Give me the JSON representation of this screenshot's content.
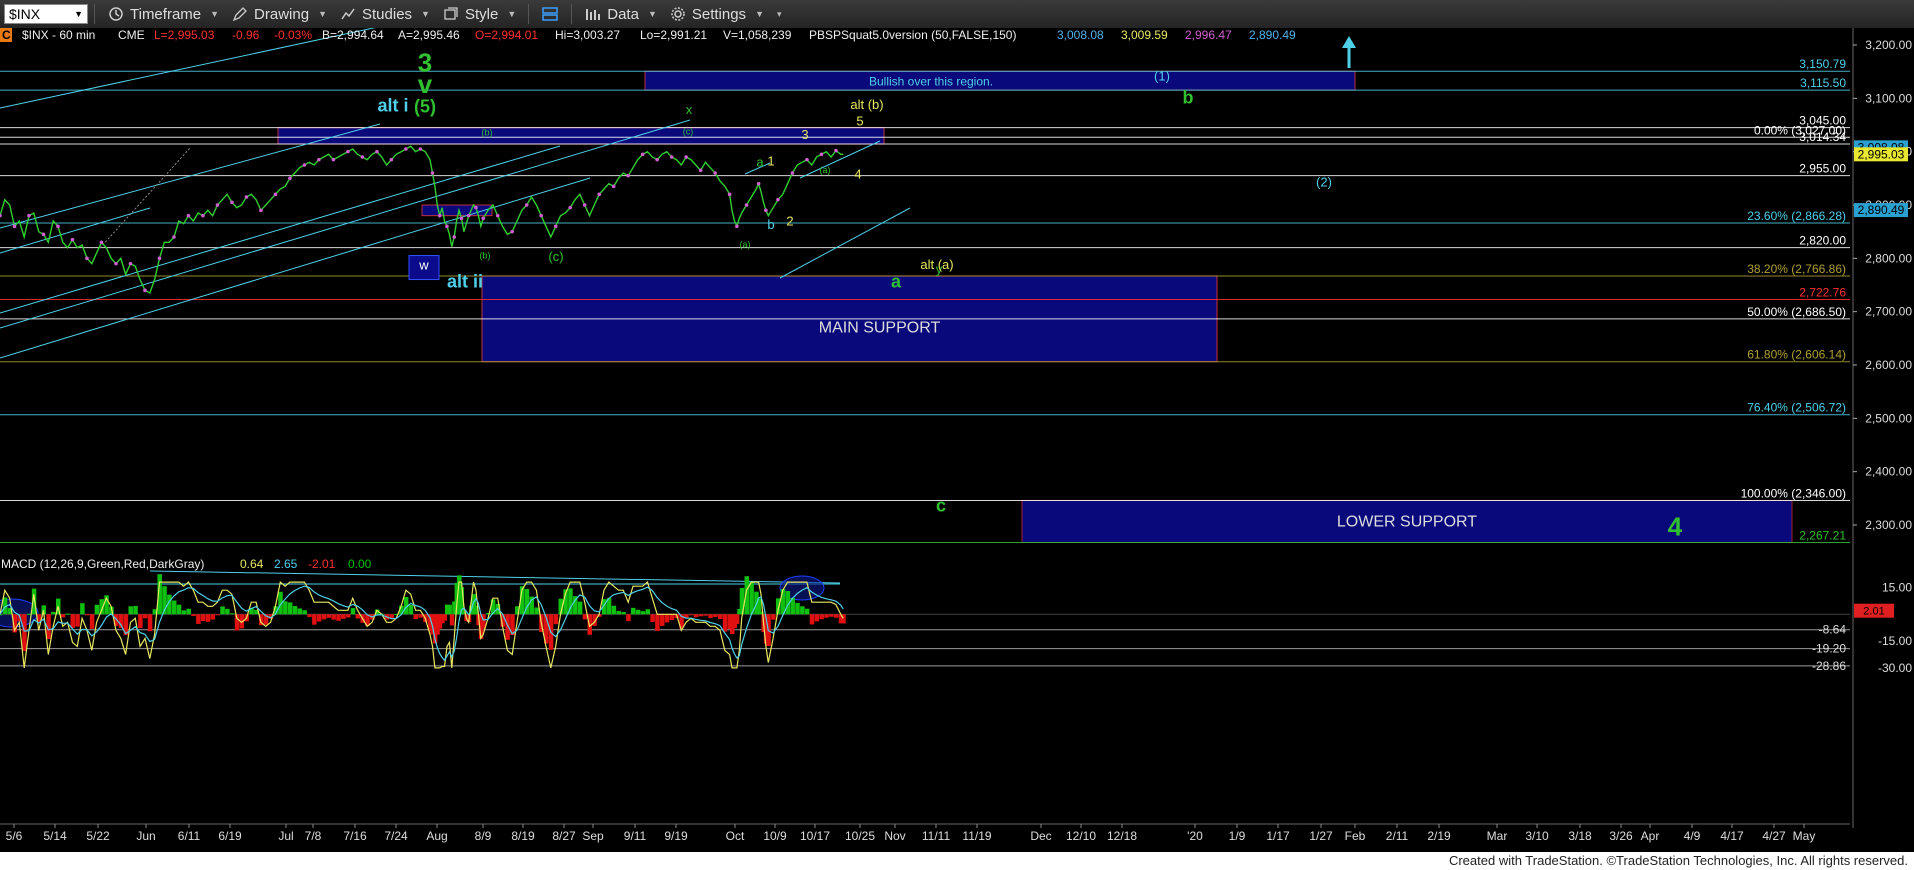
{
  "toolbar": {
    "symbol": "$INX",
    "items": [
      {
        "label": "Timeframe",
        "icon": "clock-icon"
      },
      {
        "label": "Drawing",
        "icon": "pen-icon"
      },
      {
        "label": "Studies",
        "icon": "studies-icon"
      },
      {
        "label": "Style",
        "icon": "style-icon"
      },
      {
        "label": "Data",
        "icon": "data-icon"
      },
      {
        "label": "Settings",
        "icon": "gear-icon"
      }
    ]
  },
  "header": {
    "badge": "C",
    "title": "$INX - 60 min",
    "exchange": "CME",
    "last": "L=2,995.03",
    "chg": "-0.96",
    "pct": "-0.03%",
    "bid": "B=2,994.64",
    "ask": "A=2,995.46",
    "open": "O=2,994.01",
    "hi": "Hi=3,003.27",
    "lo": "Lo=2,991.21",
    "vol": "V=1,058,239",
    "study": "PBSPSquat5.0version (50,FALSE,150)",
    "study_vals": [
      {
        "v": "3,008.08",
        "color": "#4fb3e8"
      },
      {
        "v": "3,009.59",
        "color": "#e8e860"
      },
      {
        "v": "2,996.47",
        "color": "#d060d0"
      },
      {
        "v": "2,890.49",
        "color": "#4fb3e8"
      }
    ]
  },
  "macd_header": {
    "title": "MACD (12,26,9,Green,Red,DarkGray)",
    "vals": [
      {
        "v": "0.64",
        "color": "#e8e860"
      },
      {
        "v": "2.65",
        "color": "#4fd0e8"
      },
      {
        "v": "-2.01",
        "color": "#ff3030"
      },
      {
        "v": "0.00",
        "color": "#00c000"
      }
    ]
  },
  "footer": "Created with TradeStation. ©TradeStation Technologies, Inc. All rights reserved.",
  "chart_data": {
    "type": "line",
    "title": "$INX - 60 min",
    "ylim": [
      2200,
      3220
    ],
    "y_ticks": [
      3200,
      3100,
      3000,
      2900,
      2800,
      2700,
      2600,
      2500,
      2400,
      2300
    ],
    "y_tick_labels": [
      "3,200.00",
      "3,100.00",
      "3,000.00",
      "2,900.00",
      "2,800.00",
      "2,700.00",
      "2,600.00",
      "2,500.00",
      "2,400.00",
      "2,300.00"
    ],
    "x_tick_labels": [
      "5/6",
      "5/14",
      "5/22",
      "Jun",
      "6/11",
      "6/19",
      "Jul",
      "7/8",
      "7/16",
      "7/24",
      "Aug",
      "8/9",
      "8/19",
      "8/27",
      "Sep",
      "9/11",
      "9/19",
      "Oct",
      "10/9",
      "10/17",
      "10/25",
      "Nov",
      "11/11",
      "11/19",
      "Dec",
      "12/10",
      "12/18",
      "'20",
      "1/9",
      "1/17",
      "1/27",
      "Feb",
      "2/11",
      "2/19",
      "Mar",
      "3/10",
      "3/18",
      "3/26",
      "Apr",
      "4/9",
      "4/17",
      "4/27",
      "May"
    ],
    "price_series": [
      [
        0,
        2880
      ],
      [
        4,
        2910
      ],
      [
        8,
        2900
      ],
      [
        12,
        2860
      ],
      [
        16,
        2870
      ],
      [
        20,
        2840
      ],
      [
        24,
        2880
      ],
      [
        28,
        2885
      ],
      [
        32,
        2850
      ],
      [
        36,
        2845
      ],
      [
        40,
        2830
      ],
      [
        44,
        2870
      ],
      [
        48,
        2860
      ],
      [
        52,
        2830
      ],
      [
        56,
        2820
      ],
      [
        60,
        2835
      ],
      [
        64,
        2820
      ],
      [
        68,
        2825
      ],
      [
        72,
        2800
      ],
      [
        76,
        2790
      ],
      [
        80,
        2810
      ],
      [
        84,
        2830
      ],
      [
        88,
        2820
      ],
      [
        92,
        2800
      ],
      [
        96,
        2790
      ],
      [
        100,
        2800
      ],
      [
        104,
        2770
      ],
      [
        108,
        2790
      ],
      [
        112,
        2785
      ],
      [
        116,
        2760
      ],
      [
        120,
        2740
      ],
      [
        124,
        2735
      ],
      [
        128,
        2760
      ],
      [
        132,
        2800
      ],
      [
        136,
        2830
      ],
      [
        140,
        2830
      ],
      [
        144,
        2840
      ],
      [
        148,
        2870
      ],
      [
        152,
        2865
      ],
      [
        156,
        2880
      ],
      [
        160,
        2870
      ],
      [
        164,
        2885
      ],
      [
        168,
        2880
      ],
      [
        172,
        2890
      ],
      [
        176,
        2880
      ],
      [
        180,
        2900
      ],
      [
        184,
        2910
      ],
      [
        188,
        2920
      ],
      [
        192,
        2905
      ],
      [
        196,
        2895
      ],
      [
        200,
        2900
      ],
      [
        204,
        2915
      ],
      [
        208,
        2920
      ],
      [
        212,
        2910
      ],
      [
        216,
        2890
      ],
      [
        220,
        2900
      ],
      [
        224,
        2910
      ],
      [
        228,
        2920
      ],
      [
        232,
        2930
      ],
      [
        236,
        2935
      ],
      [
        240,
        2950
      ],
      [
        244,
        2960
      ],
      [
        248,
        2970
      ],
      [
        252,
        2975
      ],
      [
        256,
        2980
      ],
      [
        260,
        2975
      ],
      [
        264,
        2985
      ],
      [
        268,
        2990
      ],
      [
        272,
        2995
      ],
      [
        276,
        2985
      ],
      [
        280,
        2990
      ],
      [
        284,
        2995
      ],
      [
        288,
        3000
      ],
      [
        292,
        3005
      ],
      [
        296,
        2995
      ],
      [
        300,
        2990
      ],
      [
        304,
        2985
      ],
      [
        308,
        2995
      ],
      [
        312,
        3000
      ],
      [
        316,
        2990
      ],
      [
        320,
        2975
      ],
      [
        324,
        2985
      ],
      [
        328,
        2995
      ],
      [
        332,
        3000
      ],
      [
        336,
        3005
      ],
      [
        340,
        3010
      ],
      [
        344,
        3000
      ],
      [
        348,
        3005
      ],
      [
        352,
        3000
      ],
      [
        356,
        2985
      ],
      [
        358,
        2960
      ],
      [
        360,
        2935
      ],
      [
        362,
        2900
      ],
      [
        364,
        2880
      ],
      [
        366,
        2895
      ],
      [
        368,
        2870
      ],
      [
        370,
        2860
      ],
      [
        372,
        2845
      ],
      [
        374,
        2822
      ],
      [
        376,
        2840
      ],
      [
        378,
        2870
      ],
      [
        380,
        2890
      ],
      [
        382,
        2875
      ],
      [
        384,
        2850
      ],
      [
        386,
        2865
      ],
      [
        388,
        2880
      ],
      [
        390,
        2890
      ],
      [
        392,
        2900
      ],
      [
        394,
        2895
      ],
      [
        396,
        2880
      ],
      [
        398,
        2860
      ],
      [
        400,
        2875
      ],
      [
        404,
        2890
      ],
      [
        408,
        2900
      ],
      [
        412,
        2880
      ],
      [
        416,
        2860
      ],
      [
        420,
        2845
      ],
      [
        424,
        2850
      ],
      [
        428,
        2870
      ],
      [
        432,
        2890
      ],
      [
        436,
        2900
      ],
      [
        440,
        2915
      ],
      [
        444,
        2900
      ],
      [
        448,
        2880
      ],
      [
        452,
        2860
      ],
      [
        456,
        2840
      ],
      [
        460,
        2860
      ],
      [
        464,
        2880
      ],
      [
        468,
        2885
      ],
      [
        472,
        2895
      ],
      [
        476,
        2910
      ],
      [
        480,
        2920
      ],
      [
        484,
        2900
      ],
      [
        488,
        2880
      ],
      [
        492,
        2900
      ],
      [
        496,
        2920
      ],
      [
        500,
        2930
      ],
      [
        504,
        2940
      ],
      [
        508,
        2935
      ],
      [
        512,
        2950
      ],
      [
        516,
        2960
      ],
      [
        520,
        2955
      ],
      [
        524,
        2970
      ],
      [
        528,
        2985
      ],
      [
        532,
        2995
      ],
      [
        536,
        3000
      ],
      [
        540,
        2990
      ],
      [
        544,
        2985
      ],
      [
        548,
        2995
      ],
      [
        552,
        3000
      ],
      [
        556,
        2990
      ],
      [
        560,
        2985
      ],
      [
        564,
        2975
      ],
      [
        568,
        2990
      ],
      [
        572,
        2985
      ],
      [
        576,
        2975
      ],
      [
        580,
        2965
      ],
      [
        584,
        2980
      ],
      [
        588,
        2970
      ],
      [
        592,
        2960
      ],
      [
        596,
        2945
      ],
      [
        600,
        2935
      ],
      [
        604,
        2920
      ],
      [
        606,
        2890
      ],
      [
        608,
        2870
      ],
      [
        610,
        2860
      ],
      [
        612,
        2875
      ],
      [
        614,
        2885
      ],
      [
        618,
        2900
      ],
      [
        622,
        2915
      ],
      [
        626,
        2930
      ],
      [
        628,
        2940
      ],
      [
        630,
        2925
      ],
      [
        632,
        2905
      ],
      [
        634,
        2890
      ],
      [
        636,
        2880
      ],
      [
        640,
        2895
      ],
      [
        644,
        2910
      ],
      [
        648,
        2920
      ],
      [
        652,
        2940
      ],
      [
        656,
        2960
      ],
      [
        660,
        2975
      ],
      [
        664,
        2980
      ],
      [
        668,
        2985
      ],
      [
        672,
        2975
      ],
      [
        676,
        2990
      ],
      [
        680,
        2995
      ],
      [
        684,
        3000
      ],
      [
        688,
        2990
      ],
      [
        692,
        3002
      ],
      [
        696,
        2995
      ],
      [
        698,
        2995
      ]
    ],
    "horizontal_levels": [
      {
        "label": "3,150.79",
        "value": 3150.79,
        "color": "#4fd0e8"
      },
      {
        "label": "3,115.50",
        "value": 3115.5,
        "color": "#4fd0e8"
      },
      {
        "label": "3,045.00",
        "value": 3045.0,
        "color": "#ffffff"
      },
      {
        "label": "0.00% (3,027.00)",
        "value": 3027.0,
        "color": "#ffffff"
      },
      {
        "label": "3,014.34",
        "value": 3014.34,
        "color": "#ffffff"
      },
      {
        "label": "2,955.00",
        "value": 2955.0,
        "color": "#ffffff"
      },
      {
        "label": "23.60% (2,866.28)",
        "value": 2866.28,
        "color": "#4fd0e8"
      },
      {
        "label": "2,820.00",
        "value": 2820.0,
        "color": "#ffffff"
      },
      {
        "label": "38.20% (2,766.86)",
        "value": 2766.86,
        "color": "#b0a030"
      },
      {
        "label": "2,722.76",
        "value": 2722.76,
        "color": "#ff3030"
      },
      {
        "label": "50.00% (2,686.50)",
        "value": 2686.5,
        "color": "#ffffff"
      },
      {
        "label": "61.80% (2,606.14)",
        "value": 2606.14,
        "color": "#b0a030"
      },
      {
        "label": "76.40% (2,506.72)",
        "value": 2506.72,
        "color": "#4fd0e8"
      },
      {
        "label": "100.00% (2,346.00)",
        "value": 2346.0,
        "color": "#ffffff"
      },
      {
        "label": "2,267.21",
        "value": 2267.21,
        "color": "#30c030"
      }
    ],
    "right_price_tags": [
      {
        "label": "3,008.08",
        "value": 3008.08,
        "bg": "#2aa0d0"
      },
      {
        "label": "2,995.03",
        "value": 2995.03,
        "bg": "#e8e830"
      },
      {
        "label": "2,890.49",
        "value": 2890.49,
        "bg": "#2aa0d0"
      }
    ],
    "zones": [
      {
        "label": "Bullish over this region.",
        "y_top": 3150.79,
        "y_bottom": 3115.5
      },
      {
        "label": "",
        "y_top": 3045,
        "y_bottom": 3014.34
      },
      {
        "label": "",
        "y_top": 2900,
        "y_bottom": 2880
      },
      {
        "label": "MAIN SUPPORT",
        "y_top": 2766.86,
        "y_bottom": 2606.14
      },
      {
        "label": "LOWER SUPPORT",
        "y_top": 2346,
        "y_bottom": 2267.21
      }
    ],
    "wave_labels": [
      {
        "text": "3",
        "color": "#30c030",
        "value": 3150,
        "size": "big"
      },
      {
        "text": "v",
        "color": "#30c030",
        "value": 3110,
        "size": "big"
      },
      {
        "text": "(5)",
        "color": "#30c030",
        "value": 3073,
        "size": "mid"
      },
      {
        "text": "alt i",
        "color": "#4fd0e8",
        "value": 3075,
        "size": "mid"
      },
      {
        "text": "x",
        "color": "#30c030",
        "value": 3071,
        "size": "small"
      },
      {
        "text": "alt (b)",
        "color": "#e8e860",
        "value": 3080,
        "size": "small"
      },
      {
        "text": "5",
        "color": "#e8e860",
        "value": 3049,
        "size": "small"
      },
      {
        "text": "(1)",
        "color": "#4fd0e8",
        "value": 3133,
        "size": "small"
      },
      {
        "text": "b",
        "color": "#30c030",
        "value": 3090,
        "size": "mid"
      },
      {
        "text": "(2)",
        "color": "#4fd0e8",
        "value": 2935,
        "size": "small"
      },
      {
        "text": "4",
        "color": "#e8e860",
        "value": 2950,
        "size": "small"
      },
      {
        "text": "1",
        "color": "#e8e860",
        "value": 2974,
        "size": "small"
      },
      {
        "text": "3",
        "color": "#e8e860",
        "value": 3024,
        "size": "small"
      },
      {
        "text": "a",
        "color": "#30c030",
        "value": 2972,
        "size": "small"
      },
      {
        "text": "b",
        "color": "#4fd0e8",
        "value": 2855,
        "size": "small"
      },
      {
        "text": "2",
        "color": "#e8e860",
        "value": 2862,
        "size": "small"
      },
      {
        "text": "(a)",
        "color": "#30c030",
        "value": 2820,
        "size": "tiny"
      },
      {
        "text": "(b)",
        "color": "#30c030",
        "value": 3030,
        "size": "tiny"
      },
      {
        "text": "(c)",
        "color": "#30c030",
        "value": 3032,
        "size": "tiny"
      },
      {
        "text": "(a)",
        "color": "#30c030",
        "value": 2960,
        "size": "tiny"
      },
      {
        "text": "(b)",
        "color": "#30c030",
        "value": 2800,
        "size": "tiny"
      },
      {
        "text": "(c)",
        "color": "#30c030",
        "value": 2795,
        "size": "small"
      },
      {
        "text": "y",
        "color": "#30c030",
        "value": 2772,
        "size": "small"
      },
      {
        "text": "alt (a)",
        "color": "#e8e860",
        "value": 2780,
        "size": "small"
      },
      {
        "text": "w",
        "color": "#ffffff",
        "value": 2779,
        "size": "box"
      },
      {
        "text": "alt ii",
        "color": "#4fd0e8",
        "value": 2745,
        "size": "mid"
      },
      {
        "text": "a",
        "color": "#30c030",
        "value": 2745,
        "size": "mid"
      },
      {
        "text": "c",
        "color": "#30c030",
        "value": 2325,
        "size": "mid"
      },
      {
        "text": "4",
        "color": "#30c030",
        "value": 2280,
        "size": "big"
      }
    ],
    "macd": {
      "ylim": [
        -34,
        22
      ],
      "tick_labels": [
        {
          "label": "15.00",
          "value": 15
        },
        {
          "label": "-15.00",
          "value": -15
        },
        {
          "label": "-30.00",
          "value": -30
        }
      ],
      "levels": [
        {
          "label": "-8.64",
          "value": -8.64
        },
        {
          "label": "-19.20",
          "value": -19.2
        },
        {
          "label": "-28.86",
          "value": -28.86
        }
      ],
      "current_tag": {
        "label": "2.01",
        "value": 2.01
      }
    }
  }
}
